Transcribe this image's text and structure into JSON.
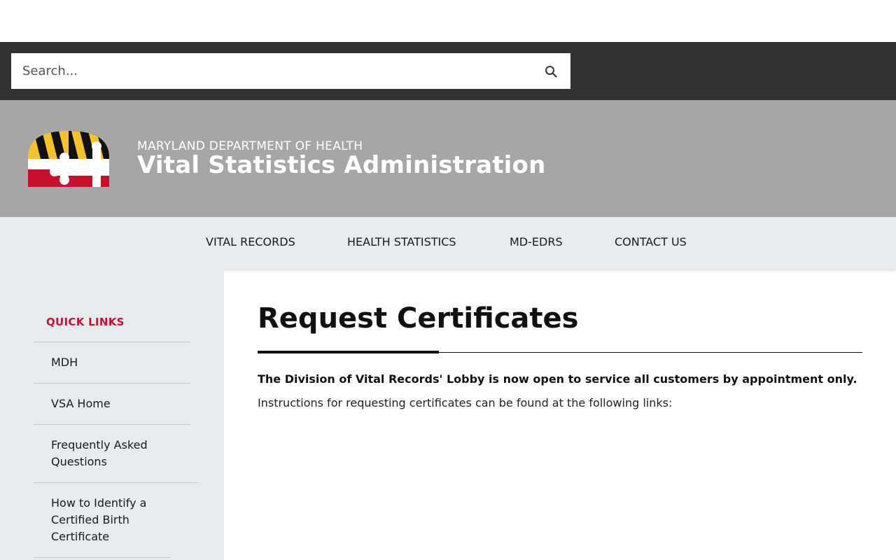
{
  "search": {
    "placeholder": "Search...",
    "icon": "search-icon"
  },
  "header": {
    "agency": "MARYLAND DEPARTMENT OF HEALTH",
    "title": "Vital Statistics Administration",
    "logo": "maryland-flag-logo"
  },
  "nav": {
    "items": [
      {
        "label": "VITAL RECORDS"
      },
      {
        "label": "HEALTH STATISTICS"
      },
      {
        "label": "MD-EDRS"
      },
      {
        "label": "CONTACT US"
      }
    ]
  },
  "sidebar": {
    "heading": "QUICK LINKS",
    "items": [
      {
        "label": "MDH"
      },
      {
        "label": "VSA Home"
      },
      {
        "label": "Frequently Asked Questions"
      },
      {
        "label": "How to Identify a Certified Birth Certificate"
      }
    ]
  },
  "main": {
    "title": "Request Certificates",
    "notice": "The Division of Vital Records' Lobby is now open to service all customers by appointment only.",
    "instructions": "Instructions for requesting certificates can be found at the following links:"
  },
  "colors": {
    "topbar": "#333333",
    "header": "#a6a6a6",
    "nav": "#e8ebee",
    "accent": "#c8102e"
  }
}
